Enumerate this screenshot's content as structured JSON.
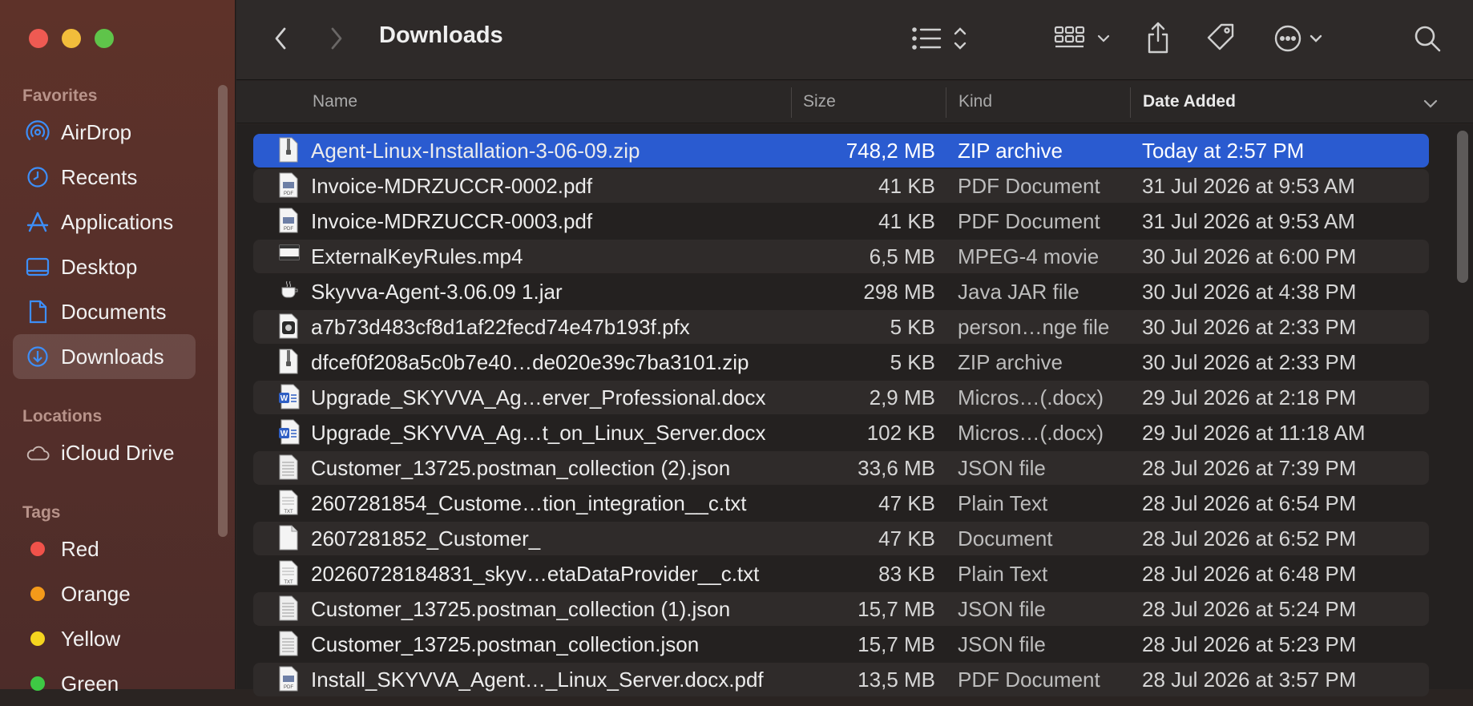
{
  "window": {
    "title": "Downloads"
  },
  "sidebar": {
    "favorites_heading": "Favorites",
    "favorites": [
      {
        "label": "AirDrop",
        "icon": "airdrop-icon"
      },
      {
        "label": "Recents",
        "icon": "clock-icon"
      },
      {
        "label": "Applications",
        "icon": "applications-icon"
      },
      {
        "label": "Desktop",
        "icon": "desktop-icon"
      },
      {
        "label": "Documents",
        "icon": "document-icon"
      },
      {
        "label": "Downloads",
        "icon": "download-icon",
        "active": true
      }
    ],
    "locations_heading": "Locations",
    "locations": [
      {
        "label": "iCloud Drive",
        "icon": "cloud-icon"
      }
    ],
    "tags_heading": "Tags",
    "tags": [
      {
        "label": "Red",
        "color": "#f0524a"
      },
      {
        "label": "Orange",
        "color": "#f49a1a"
      },
      {
        "label": "Yellow",
        "color": "#f5d51f"
      },
      {
        "label": "Green",
        "color": "#3ec944"
      }
    ]
  },
  "columns": {
    "name": "Name",
    "size": "Size",
    "kind": "Kind",
    "date": "Date Added"
  },
  "colors": {
    "accent": "#2a5bd0"
  },
  "files": [
    {
      "name": "Agent-Linux-Installation-3-06-09.zip",
      "size": "748,2 MB",
      "kind": "ZIP archive",
      "date": "Today at 2:57 PM",
      "icon": "zip-file-icon",
      "selected": true
    },
    {
      "name": "Invoice-MDRZUCCR-0002.pdf",
      "size": "41 KB",
      "kind": "PDF Document",
      "date": "31 Jul 2026 at 9:53 AM",
      "icon": "pdf-file-icon"
    },
    {
      "name": "Invoice-MDRZUCCR-0003.pdf",
      "size": "41 KB",
      "kind": "PDF Document",
      "date": "31 Jul 2026 at 9:53 AM",
      "icon": "pdf-file-icon"
    },
    {
      "name": "ExternalKeyRules.mp4",
      "size": "6,5 MB",
      "kind": "MPEG-4 movie",
      "date": "30 Jul 2026 at 6:00 PM",
      "icon": "video-file-icon"
    },
    {
      "name": "Skyvva-Agent-3.06.09 1.jar",
      "size": "298 MB",
      "kind": "Java JAR file",
      "date": "30 Jul 2026 at 4:38 PM",
      "icon": "jar-file-icon"
    },
    {
      "name": "a7b73d483cf8d1af22fecd74e47b193f.pfx",
      "size": "5 KB",
      "kind": "person…nge file",
      "date": "30 Jul 2026 at 2:33 PM",
      "icon": "certificate-file-icon"
    },
    {
      "name": "dfcef0f208a5c0b7e40…de020e39c7ba3101.zip",
      "size": "5 KB",
      "kind": "ZIP archive",
      "date": "30 Jul 2026 at 2:33 PM",
      "icon": "zip-file-icon"
    },
    {
      "name": "Upgrade_SKYVVA_Ag…erver_Professional.docx",
      "size": "2,9 MB",
      "kind": "Micros…(.docx)",
      "date": "29 Jul 2026 at 2:18 PM",
      "icon": "word-file-icon"
    },
    {
      "name": "Upgrade_SKYVVA_Ag…t_on_Linux_Server.docx",
      "size": "102 KB",
      "kind": "Micros…(.docx)",
      "date": "29 Jul 2026 at 11:18 AM",
      "icon": "word-file-icon"
    },
    {
      "name": "Customer_13725.postman_collection (2).json",
      "size": "33,6 MB",
      "kind": "JSON file",
      "date": "28 Jul 2026 at 7:39 PM",
      "icon": "json-file-icon"
    },
    {
      "name": "2607281854_Custome…tion_integration__c.txt",
      "size": "47 KB",
      "kind": "Plain Text",
      "date": "28 Jul 2026 at 6:54 PM",
      "icon": "text-file-icon"
    },
    {
      "name": "2607281852_Customer_",
      "size": "47 KB",
      "kind": "Document",
      "date": "28 Jul 2026 at 6:52 PM",
      "icon": "blank-file-icon"
    },
    {
      "name": "20260728184831_skyv…etaDataProvider__c.txt",
      "size": "83 KB",
      "kind": "Plain Text",
      "date": "28 Jul 2026 at 6:48 PM",
      "icon": "text-file-icon"
    },
    {
      "name": "Customer_13725.postman_collection (1).json",
      "size": "15,7 MB",
      "kind": "JSON file",
      "date": "28 Jul 2026 at 5:24 PM",
      "icon": "json-file-icon"
    },
    {
      "name": "Customer_13725.postman_collection.json",
      "size": "15,7 MB",
      "kind": "JSON file",
      "date": "28 Jul 2026 at 5:23 PM",
      "icon": "json-file-icon"
    },
    {
      "name": "Install_SKYVVA_Agent…_Linux_Server.docx.pdf",
      "size": "13,5 MB",
      "kind": "PDF Document",
      "date": "28 Jul 2026 at 3:57 PM",
      "icon": "pdf-file-icon"
    }
  ]
}
